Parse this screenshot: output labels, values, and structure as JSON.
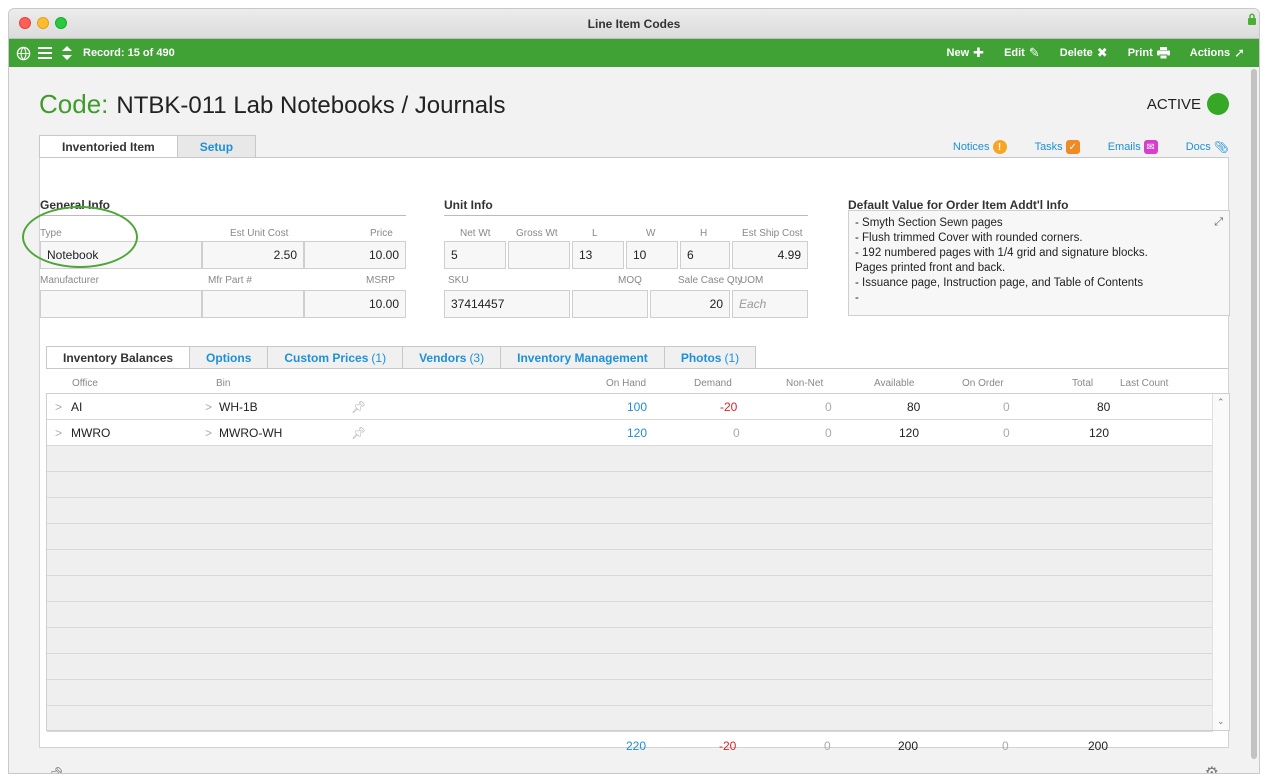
{
  "window": {
    "title": "Line Item Codes"
  },
  "toolbar": {
    "record": "Record: 15 of 490",
    "actions": [
      {
        "label": "New",
        "icon": "plus-icon"
      },
      {
        "label": "Edit",
        "icon": "pencil-icon"
      },
      {
        "label": "Delete",
        "icon": "x-icon"
      },
      {
        "label": "Print",
        "icon": "printer-icon"
      },
      {
        "label": "Actions",
        "icon": "arrow-out-icon"
      }
    ]
  },
  "header": {
    "code_label": "Code:",
    "code_value": "NTBK-011 Lab Notebooks / Journals",
    "status": "ACTIVE",
    "status_color": "#35a826"
  },
  "main_tabs": [
    {
      "label": "Inventoried Item"
    },
    {
      "label": "Setup"
    }
  ],
  "header_links": [
    {
      "label": "Notices",
      "icon": "alert-icon"
    },
    {
      "label": "Tasks",
      "icon": "checkbox-icon"
    },
    {
      "label": "Emails",
      "icon": "envelope-icon"
    },
    {
      "label": "Docs",
      "icon": "paperclip-icon"
    }
  ],
  "general_info": {
    "title": "General Info",
    "type_label": "Type",
    "type": "Notebook",
    "est_unit_cost_label": "Est Unit Cost",
    "est_unit_cost": "2.50",
    "price_label": "Price",
    "price": "10.00",
    "manufacturer_label": "Manufacturer",
    "manufacturer": "",
    "mfr_part_label": "Mfr Part #",
    "mfr_part": "",
    "msrp_label": "MSRP",
    "msrp": "10.00"
  },
  "unit_info": {
    "title": "Unit Info",
    "net_wt_label": "Net Wt",
    "net_wt": "5",
    "gross_wt_label": "Gross Wt",
    "gross_wt": "",
    "l_label": "L",
    "l": "13",
    "w_label": "W",
    "w": "10",
    "h_label": "H",
    "h": "6",
    "est_ship_cost_label": "Est Ship Cost",
    "est_ship_cost": "4.99",
    "sku_label": "SKU",
    "sku": "37414457",
    "moq_label": "MOQ",
    "moq": "",
    "sale_case_qty_label": "Sale Case Qty",
    "sale_case_qty": "20",
    "uom_label": "UOM",
    "uom_placeholder": "Each"
  },
  "default_value": {
    "title": "Default Value for Order Item Addt'l Info",
    "lines": [
      "- Smyth Section Sewn pages",
      "- Flush trimmed Cover with rounded corners.",
      "- 192 numbered pages with 1/4 grid and signature blocks.",
      "Pages printed front and back.",
      "- Issuance page, Instruction page, and Table of Contents",
      "-"
    ]
  },
  "sub_tabs": [
    {
      "label": "Inventory Balances",
      "count": ""
    },
    {
      "label": "Options",
      "count": ""
    },
    {
      "label": "Custom Prices",
      "count": "(1)"
    },
    {
      "label": "Vendors",
      "count": "(3)"
    },
    {
      "label": "Inventory Management",
      "count": ""
    },
    {
      "label": "Photos",
      "count": "(1)"
    }
  ],
  "balances": {
    "columns": [
      "Office",
      "Bin",
      "On Hand",
      "Demand",
      "Non-Net",
      "Available",
      "On Order",
      "Total",
      "Last Count"
    ],
    "rows": [
      {
        "office": "AI",
        "bin": "WH-1B",
        "on_hand": "100",
        "demand": "-20",
        "non_net": "0",
        "available": "80",
        "on_order": "0",
        "total": "80",
        "last_count": ""
      },
      {
        "office": "MWRO",
        "bin": "MWRO-WH",
        "on_hand": "120",
        "demand": "0",
        "non_net": "0",
        "available": "120",
        "on_order": "0",
        "total": "120",
        "last_count": ""
      }
    ],
    "totals": {
      "on_hand": "220",
      "demand": "-20",
      "non_net": "0",
      "available": "200",
      "on_order": "0",
      "total": "200"
    }
  },
  "colors": {
    "accent_green": "#40a234",
    "link_blue": "#1e8ed6",
    "negative_red": "#e0202a"
  }
}
